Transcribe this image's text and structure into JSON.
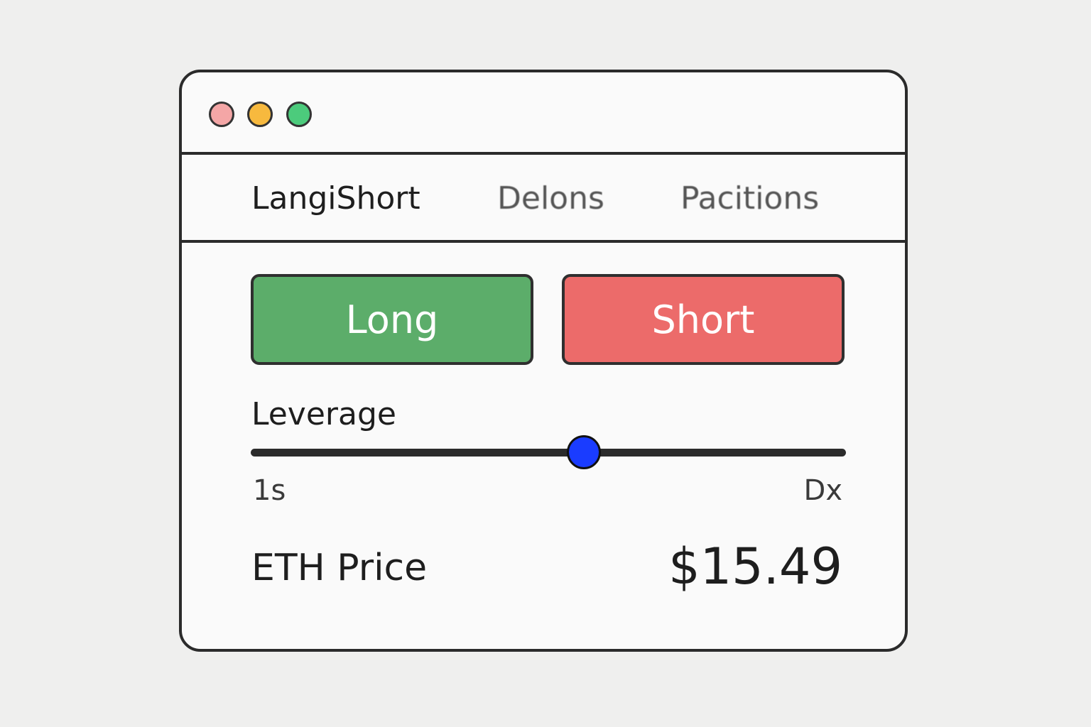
{
  "window": {
    "controls": [
      {
        "name": "close",
        "color": "#f4a6a6"
      },
      {
        "name": "minimize",
        "color": "#f7b93e"
      },
      {
        "name": "maximize",
        "color": "#4ccb7c"
      }
    ]
  },
  "tabs": [
    {
      "label": "LangiShort",
      "active": true
    },
    {
      "label": "Delons",
      "active": false
    },
    {
      "label": "Pacitions",
      "active": false
    }
  ],
  "actions": {
    "long_label": "Long",
    "long_color": "#5cad6a",
    "short_label": "Short",
    "short_color": "#ec6b6a"
  },
  "leverage": {
    "label": "Leverage",
    "min_label": "1s",
    "max_label": "Dx",
    "value_fraction": 0.56,
    "thumb_color": "#1a3cff"
  },
  "price": {
    "label": "ETH Price",
    "value": "$15.49"
  }
}
